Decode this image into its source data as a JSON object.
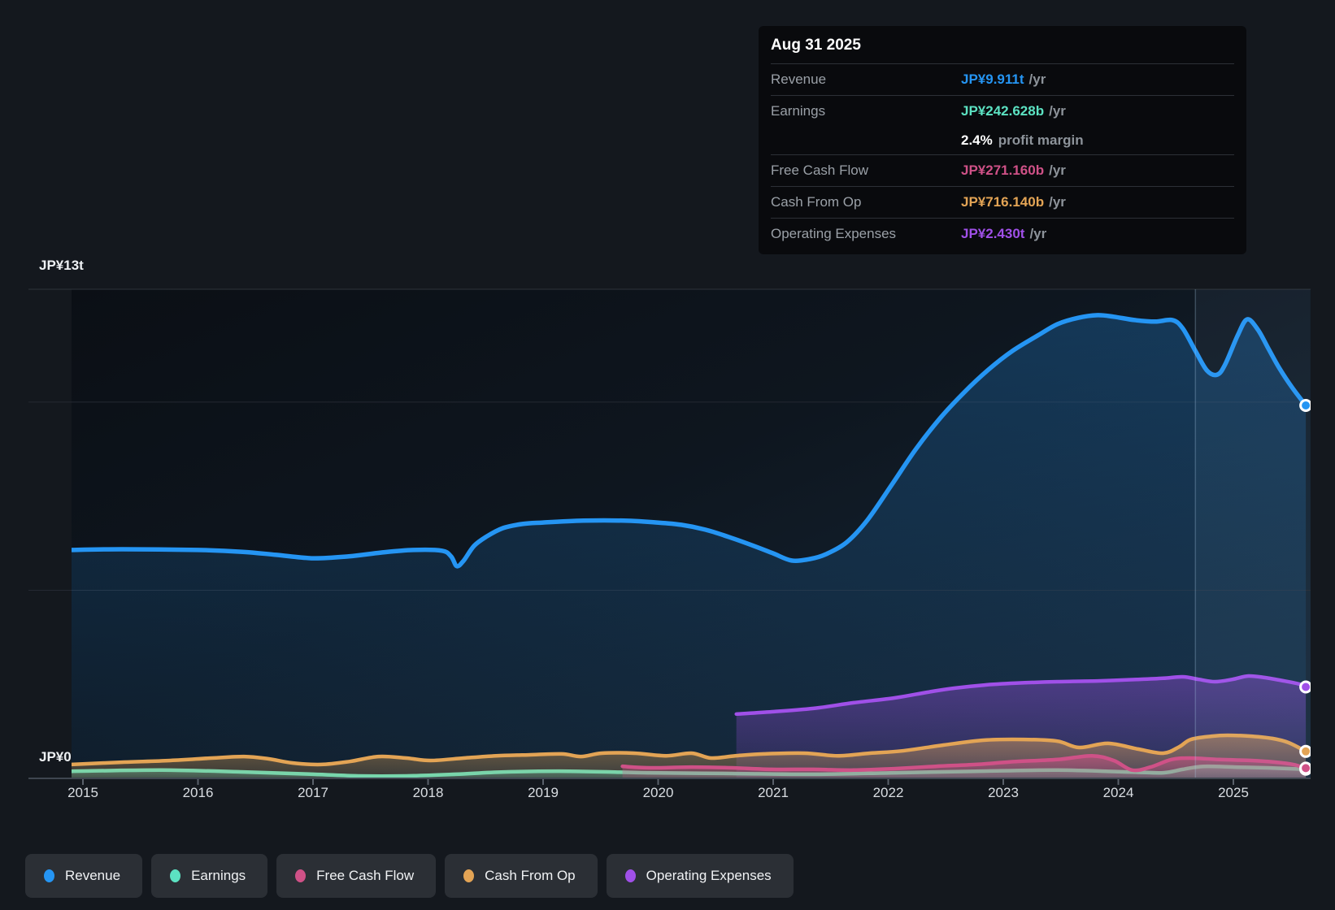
{
  "tooltip": {
    "date": "Aug 31 2025",
    "rows": [
      {
        "label": "Revenue",
        "value": "JP¥9.911t",
        "suffix": "/yr",
        "color_key": "revenue"
      },
      {
        "label": "Earnings",
        "value": "JP¥242.628b",
        "suffix": "/yr",
        "color_key": "earnings"
      },
      {
        "label": "Free Cash Flow",
        "value": "JP¥271.160b",
        "suffix": "/yr",
        "color_key": "fcf"
      },
      {
        "label": "Cash From Op",
        "value": "JP¥716.140b",
        "suffix": "/yr",
        "color_key": "cash_ops"
      },
      {
        "label": "Operating Expenses",
        "value": "JP¥2.430t",
        "suffix": "/yr",
        "color_key": "opex"
      }
    ],
    "profit_margin": {
      "value": "2.4%",
      "text": "profit margin"
    }
  },
  "colors": {
    "revenue": "#2595f3",
    "earnings": "#5ce2c2",
    "fcf": "#cf5187",
    "cash_ops": "#e3a455",
    "opex": "#a050e8"
  },
  "axis": {
    "y_top_label": "JP¥13t",
    "y_zero_label": "JP¥0",
    "x_ticks": [
      "2015",
      "2016",
      "2017",
      "2018",
      "2019",
      "2020",
      "2021",
      "2022",
      "2023",
      "2024",
      "2025"
    ]
  },
  "legend": {
    "items": [
      {
        "label": "Revenue",
        "color_key": "revenue"
      },
      {
        "label": "Earnings",
        "color_key": "earnings"
      },
      {
        "label": "Free Cash Flow",
        "color_key": "fcf"
      },
      {
        "label": "Cash From Op",
        "color_key": "cash_ops"
      },
      {
        "label": "Operating Expenses",
        "color_key": "opex"
      }
    ]
  },
  "chart_data": {
    "type": "area",
    "x_unit": "year",
    "y_unit": "JP¥ trillions",
    "ylim": [
      0,
      13
    ],
    "xlim": [
      2014.9,
      2025.67
    ],
    "gridline_values": [
      13,
      10,
      5
    ],
    "ttm_highlight": {
      "from_year": 2024.67,
      "to_year": 2025.67
    },
    "end_markers": true,
    "series": [
      {
        "name": "Revenue",
        "color_key": "revenue",
        "points": [
          [
            2014.9,
            6.07
          ],
          [
            2015.34,
            6.09
          ],
          [
            2016.0,
            6.07
          ],
          [
            2016.39,
            6.02
          ],
          [
            2016.68,
            5.94
          ],
          [
            2017.0,
            5.85
          ],
          [
            2017.31,
            5.9
          ],
          [
            2017.59,
            6.0
          ],
          [
            2017.87,
            6.07
          ],
          [
            2018.12,
            6.05
          ],
          [
            2018.2,
            5.9
          ],
          [
            2018.25,
            5.64
          ],
          [
            2018.31,
            5.79
          ],
          [
            2018.4,
            6.18
          ],
          [
            2018.51,
            6.43
          ],
          [
            2018.65,
            6.65
          ],
          [
            2018.82,
            6.76
          ],
          [
            2019.0,
            6.8
          ],
          [
            2019.35,
            6.85
          ],
          [
            2019.7,
            6.85
          ],
          [
            2019.99,
            6.8
          ],
          [
            2020.2,
            6.74
          ],
          [
            2020.41,
            6.61
          ],
          [
            2020.62,
            6.41
          ],
          [
            2020.83,
            6.18
          ],
          [
            2021.0,
            5.98
          ],
          [
            2021.16,
            5.79
          ],
          [
            2021.32,
            5.83
          ],
          [
            2021.46,
            5.96
          ],
          [
            2021.64,
            6.28
          ],
          [
            2021.82,
            6.87
          ],
          [
            2022.03,
            7.8
          ],
          [
            2022.24,
            8.75
          ],
          [
            2022.45,
            9.57
          ],
          [
            2022.66,
            10.26
          ],
          [
            2022.87,
            10.86
          ],
          [
            2023.08,
            11.36
          ],
          [
            2023.3,
            11.77
          ],
          [
            2023.47,
            12.07
          ],
          [
            2023.65,
            12.24
          ],
          [
            2023.82,
            12.31
          ],
          [
            2023.96,
            12.27
          ],
          [
            2024.14,
            12.18
          ],
          [
            2024.32,
            12.14
          ],
          [
            2024.47,
            12.18
          ],
          [
            2024.56,
            11.96
          ],
          [
            2024.67,
            11.36
          ],
          [
            2024.77,
            10.84
          ],
          [
            2024.86,
            10.73
          ],
          [
            2024.93,
            11.01
          ],
          [
            2025.04,
            11.79
          ],
          [
            2025.12,
            12.2
          ],
          [
            2025.21,
            11.94
          ],
          [
            2025.3,
            11.45
          ],
          [
            2025.4,
            10.9
          ],
          [
            2025.51,
            10.39
          ],
          [
            2025.63,
            9.911
          ]
        ]
      },
      {
        "name": "Operating Expenses",
        "color_key": "opex",
        "points": [
          [
            2020.68,
            1.71
          ],
          [
            2020.99,
            1.77
          ],
          [
            2021.35,
            1.86
          ],
          [
            2021.7,
            2.01
          ],
          [
            2022.06,
            2.14
          ],
          [
            2022.34,
            2.29
          ],
          [
            2022.58,
            2.4
          ],
          [
            2022.83,
            2.48
          ],
          [
            2023.11,
            2.53
          ],
          [
            2023.47,
            2.57
          ],
          [
            2023.82,
            2.59
          ],
          [
            2024.17,
            2.63
          ],
          [
            2024.39,
            2.66
          ],
          [
            2024.56,
            2.7
          ],
          [
            2024.7,
            2.63
          ],
          [
            2024.84,
            2.57
          ],
          [
            2024.99,
            2.63
          ],
          [
            2025.13,
            2.72
          ],
          [
            2025.27,
            2.68
          ],
          [
            2025.44,
            2.59
          ],
          [
            2025.58,
            2.5
          ],
          [
            2025.63,
            2.43
          ]
        ]
      },
      {
        "name": "Earnings",
        "color_key": "earnings",
        "points": [
          [
            2014.9,
            0.19
          ],
          [
            2015.69,
            0.22
          ],
          [
            2016.4,
            0.17
          ],
          [
            2017.0,
            0.11
          ],
          [
            2017.39,
            0.065
          ],
          [
            2017.81,
            0.065
          ],
          [
            2018.24,
            0.11
          ],
          [
            2018.66,
            0.17
          ],
          [
            2019.23,
            0.19
          ],
          [
            2019.93,
            0.15
          ],
          [
            2020.64,
            0.13
          ],
          [
            2021.35,
            0.11
          ],
          [
            2022.06,
            0.15
          ],
          [
            2022.76,
            0.19
          ],
          [
            2023.47,
            0.22
          ],
          [
            2024.1,
            0.17
          ],
          [
            2024.39,
            0.15
          ],
          [
            2024.56,
            0.24
          ],
          [
            2024.74,
            0.32
          ],
          [
            2025.02,
            0.3
          ],
          [
            2025.3,
            0.28
          ],
          [
            2025.63,
            0.243
          ]
        ]
      },
      {
        "name": "Cash From Op",
        "color_key": "cash_ops",
        "points": [
          [
            2014.9,
            0.37
          ],
          [
            2015.34,
            0.43
          ],
          [
            2015.76,
            0.475
          ],
          [
            2016.12,
            0.54
          ],
          [
            2016.4,
            0.58
          ],
          [
            2016.61,
            0.52
          ],
          [
            2016.82,
            0.41
          ],
          [
            2017.07,
            0.37
          ],
          [
            2017.32,
            0.45
          ],
          [
            2017.57,
            0.58
          ],
          [
            2017.81,
            0.54
          ],
          [
            2018.02,
            0.475
          ],
          [
            2018.31,
            0.54
          ],
          [
            2018.59,
            0.6
          ],
          [
            2018.87,
            0.625
          ],
          [
            2019.16,
            0.65
          ],
          [
            2019.33,
            0.58
          ],
          [
            2019.51,
            0.67
          ],
          [
            2019.79,
            0.67
          ],
          [
            2020.07,
            0.6
          ],
          [
            2020.29,
            0.67
          ],
          [
            2020.46,
            0.54
          ],
          [
            2020.67,
            0.6
          ],
          [
            2020.92,
            0.65
          ],
          [
            2021.27,
            0.67
          ],
          [
            2021.56,
            0.6
          ],
          [
            2021.84,
            0.67
          ],
          [
            2022.12,
            0.73
          ],
          [
            2022.48,
            0.885
          ],
          [
            2022.83,
            1.015
          ],
          [
            2023.18,
            1.035
          ],
          [
            2023.47,
            0.99
          ],
          [
            2023.66,
            0.82
          ],
          [
            2023.91,
            0.93
          ],
          [
            2024.17,
            0.78
          ],
          [
            2024.39,
            0.67
          ],
          [
            2024.53,
            0.84
          ],
          [
            2024.63,
            1.035
          ],
          [
            2024.81,
            1.12
          ],
          [
            2024.95,
            1.145
          ],
          [
            2025.16,
            1.12
          ],
          [
            2025.34,
            1.06
          ],
          [
            2025.48,
            0.95
          ],
          [
            2025.63,
            0.716
          ]
        ]
      },
      {
        "name": "Free Cash Flow",
        "color_key": "fcf",
        "points": [
          [
            2019.69,
            0.32
          ],
          [
            2019.93,
            0.28
          ],
          [
            2020.29,
            0.3
          ],
          [
            2020.64,
            0.28
          ],
          [
            2020.99,
            0.24
          ],
          [
            2021.35,
            0.24
          ],
          [
            2021.7,
            0.22
          ],
          [
            2022.06,
            0.26
          ],
          [
            2022.41,
            0.32
          ],
          [
            2022.76,
            0.37
          ],
          [
            2023.11,
            0.45
          ],
          [
            2023.47,
            0.5
          ],
          [
            2023.77,
            0.6
          ],
          [
            2023.96,
            0.475
          ],
          [
            2024.12,
            0.22
          ],
          [
            2024.28,
            0.3
          ],
          [
            2024.46,
            0.5
          ],
          [
            2024.62,
            0.54
          ],
          [
            2024.88,
            0.5
          ],
          [
            2025.16,
            0.475
          ],
          [
            2025.37,
            0.43
          ],
          [
            2025.52,
            0.37
          ],
          [
            2025.63,
            0.271
          ]
        ]
      }
    ]
  }
}
